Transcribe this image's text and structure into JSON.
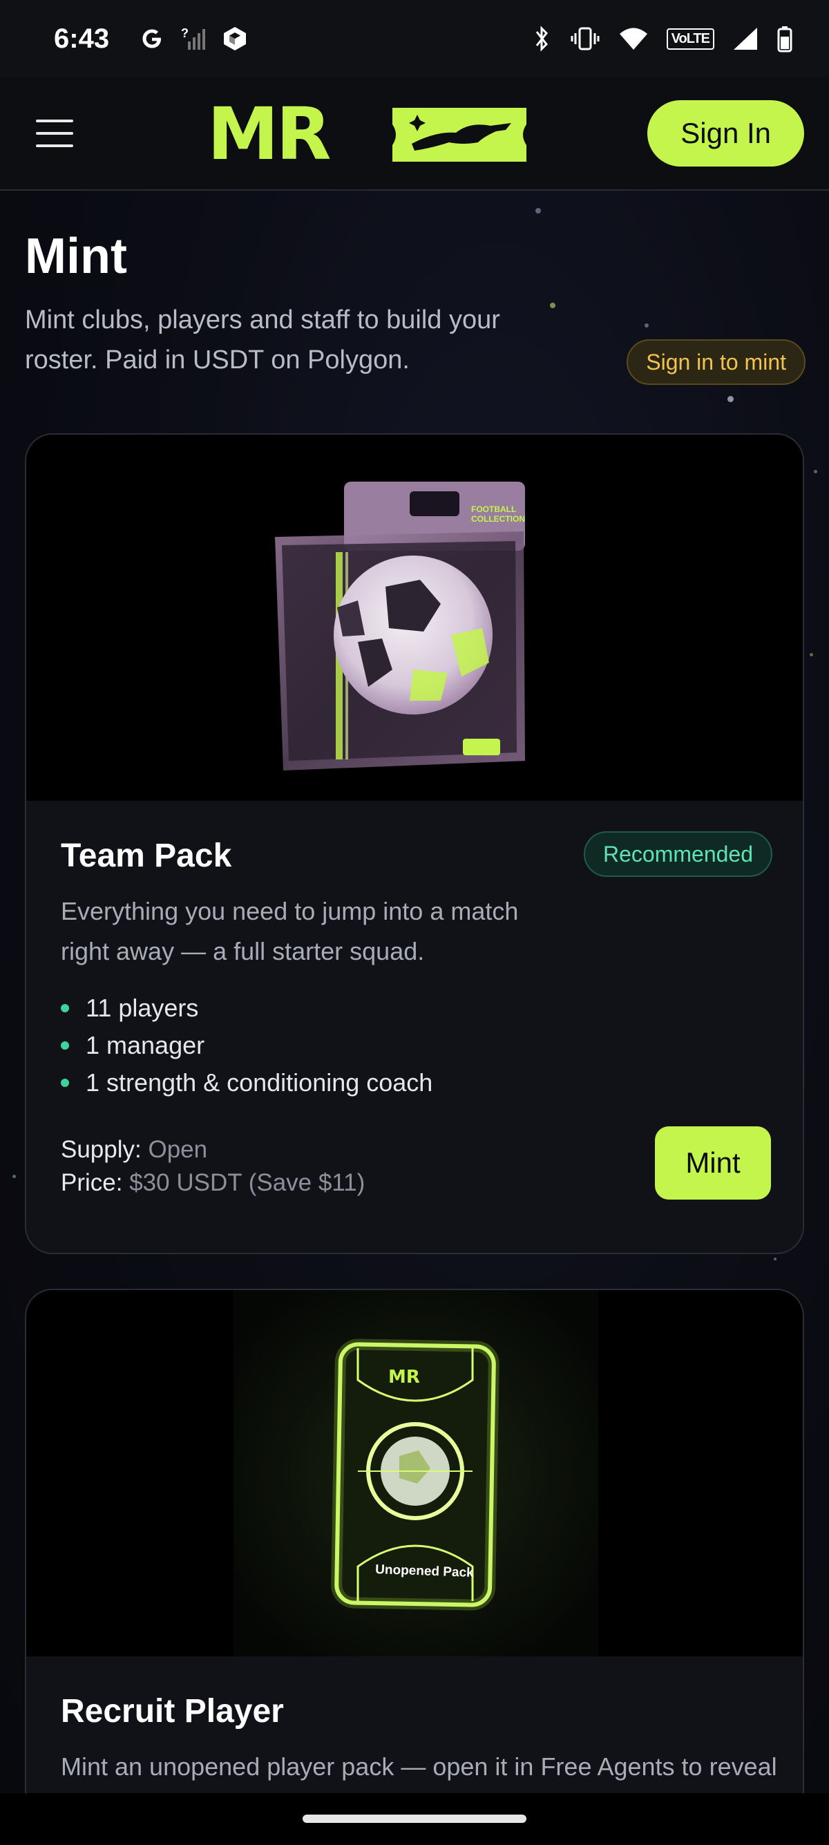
{
  "status_bar": {
    "time": "6:43",
    "left_icons": [
      "google-icon",
      "no-signal-icon",
      "cube-app-icon"
    ],
    "right_icons": [
      "bluetooth-icon",
      "vibrate-icon",
      "wifi-icon",
      "volte-icon",
      "cell-signal-icon",
      "battery-icon"
    ],
    "volte_label": "VoLTE"
  },
  "header": {
    "logo_text": "MR",
    "sign_in_label": "Sign In",
    "accent_color": "#c4f54c"
  },
  "page": {
    "title": "Mint",
    "subtitle": "Mint clubs, players and staff to build your roster. Paid in USDT on Polygon.",
    "sign_in_badge": "Sign in to mint"
  },
  "cards": [
    {
      "title": "Team Pack",
      "badge": "Recommended",
      "description": "Everything you need to jump into a match right away — a full starter squad.",
      "features": [
        "11 players",
        "1 manager",
        "1 strength & conditioning coach"
      ],
      "supply_label": "Supply:",
      "supply_value": "Open",
      "price_label": "Price:",
      "price_value": "$30 USDT (Save $11)",
      "button_label": "Mint",
      "media_text": [
        "FOOTBALL",
        "COLLECTION"
      ]
    },
    {
      "title": "Recruit Player",
      "description": "Mint an unopened player pack — open it in Free Agents to reveal",
      "media_text": [
        "Unopened Pack"
      ]
    }
  ]
}
